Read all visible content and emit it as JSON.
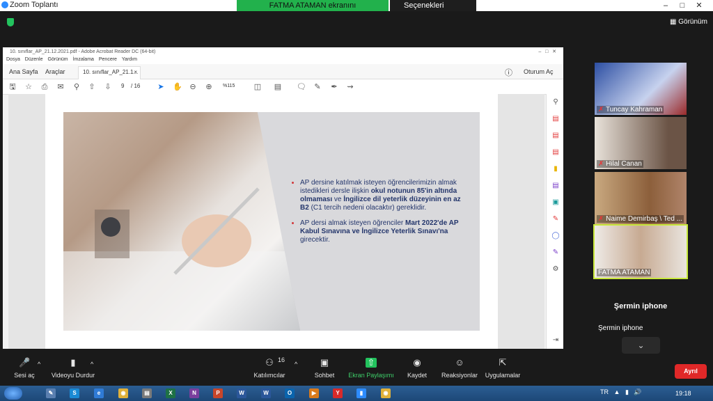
{
  "zoom": {
    "title": "Zoom Toplantı",
    "share_banner": "FATMA ATAMAN  ekranını görüntülüyorsunuz",
    "view_options": "Seçenekleri Görüntüle",
    "gallery_view": "Görünüm"
  },
  "acrobat": {
    "title": "10. sınıflar_AP_21.12.2021.pdf - Adobe Acrobat Reader DC (64-bit)",
    "menu": [
      "Dosya",
      "Düzenle",
      "Görünüm",
      "İmzalama",
      "Pencere",
      "Yardım"
    ],
    "tabs": {
      "home": "Ana Sayfa",
      "tools": "Araçlar",
      "doc": "10. sınıflar_AP_21.1..."
    },
    "sign_in": "Oturum Aç",
    "page_current": "9",
    "page_total": "/ 16",
    "zoom_level": "%115",
    "slide": {
      "bullet1": [
        "AP dersine katılmak isteyen öğrencilerimizin almak istedikleri dersle ilişkin ",
        "okul notunun 85'in altında olmaması",
        " ve ",
        "İngilizce dil yeterlik düzeyinin en az B2",
        " (C1 tercih nedeni olacaktır) gereklidir."
      ],
      "bullet2": [
        "AP dersi almak isteyen öğrenciler ",
        "Mart 2022'de AP Kabul Sınavına ve İngilizce Yeterlik Sınavı'na",
        " girecektir."
      ]
    }
  },
  "participants": [
    {
      "name": "Tuncay Kahraman",
      "muted": true
    },
    {
      "name": "Hilal Canan",
      "muted": true
    },
    {
      "name": "Naime Demirbaş \\ Ted ...",
      "muted": true
    },
    {
      "name": "FATMA ATAMAN",
      "muted": false
    },
    {
      "name": "Şermin iphone",
      "big_name": "Şermin iphone"
    }
  ],
  "toolbar": {
    "mute": "Sesi aç",
    "video": "Videoyu Durdur",
    "participants": "Katılımcılar",
    "participants_count": "16",
    "chat": "Sohbet",
    "share": "Ekran Paylaşımı",
    "record": "Kaydet",
    "reactions": "Reaksiyonlar",
    "apps": "Uygulamalar",
    "leave": "Ayrıl"
  },
  "taskbar": {
    "lang": "TR",
    "time": "19:18"
  },
  "colors": {
    "share_green": "#22b14c",
    "leave_red": "#e02828",
    "active_speaker": "#c8e83b",
    "slide_text": "#23356b"
  }
}
